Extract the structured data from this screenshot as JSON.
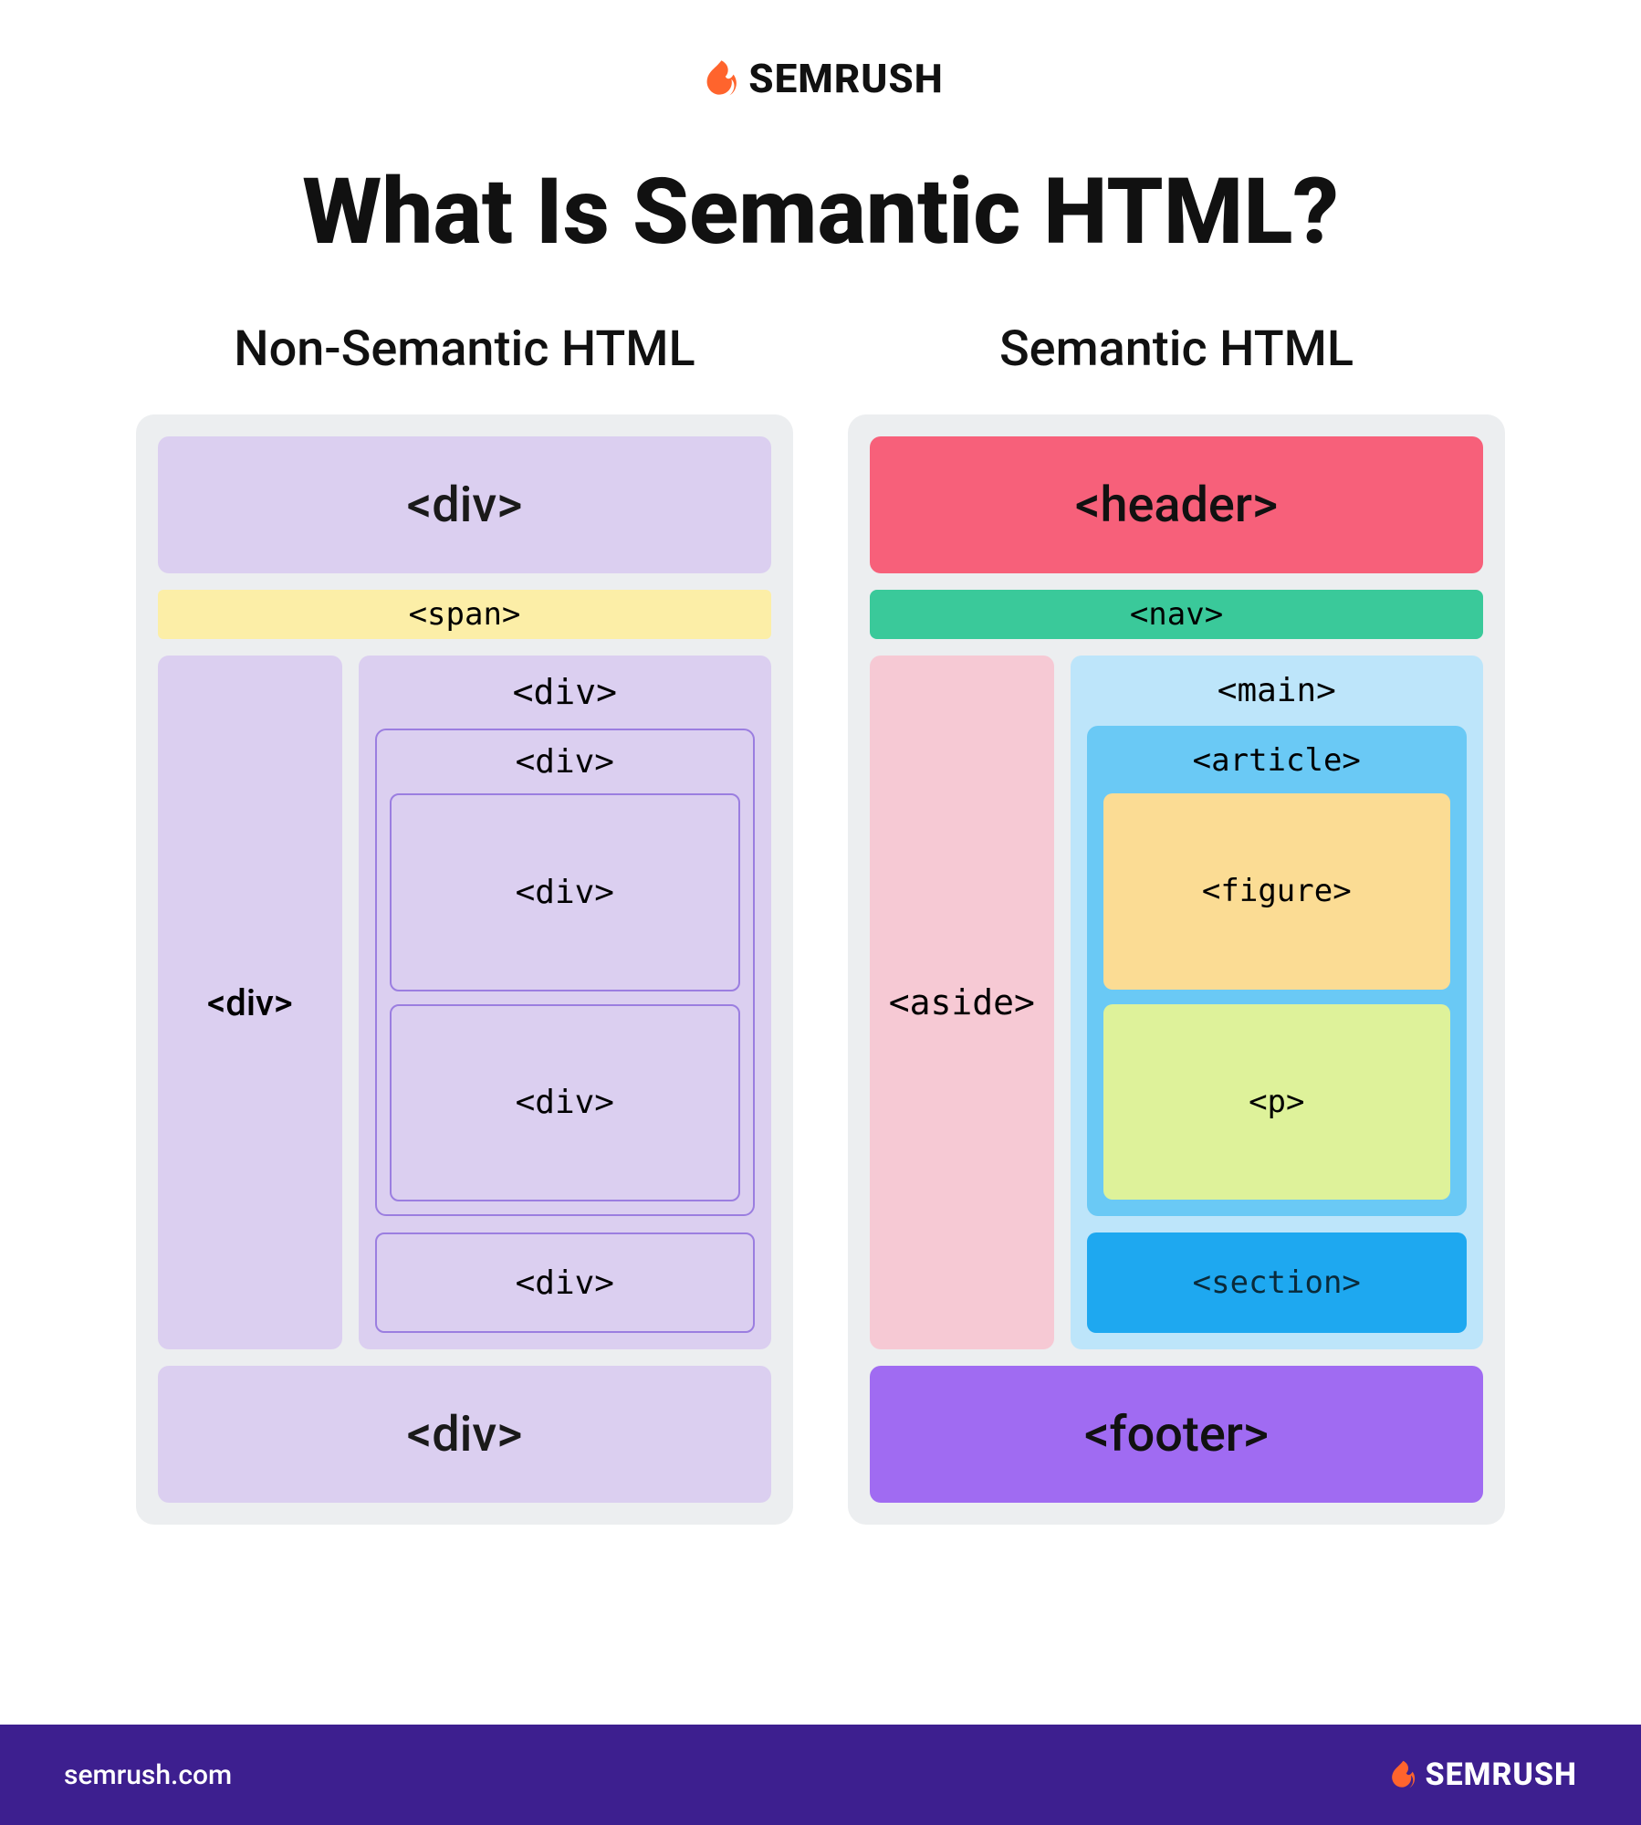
{
  "brand": {
    "name": "SEMRUSH",
    "color_accent": "#ff642d",
    "url": "semrush.com"
  },
  "title": "What Is Semantic HTML?",
  "columns": {
    "non_semantic": {
      "heading": "Non-Semantic HTML",
      "header": "<div>",
      "nav": "<span>",
      "aside": "<div>",
      "main": "<div>",
      "article": "<div>",
      "figure": "<div>",
      "p": "<div>",
      "section": "<div>",
      "footer": "<div>"
    },
    "semantic": {
      "heading": "Semantic HTML",
      "header": "<header>",
      "nav": "<nav>",
      "aside": "<aside>",
      "main": "<main>",
      "article": "<article>",
      "figure": "<figure>",
      "p": "<p>",
      "section": "<section>",
      "footer": "<footer>"
    }
  },
  "colors": {
    "frame_bg": "#eceef0",
    "ns_fill": "#dbcff0",
    "ns_outline": "#9b7ee0",
    "span_bg": "#fceea7",
    "header_bg": "#f7607a",
    "nav_bg": "#3ac99a",
    "aside_bg": "#f6c9d4",
    "main_bg": "#bde5fa",
    "article_bg": "#6ac9f5",
    "figure_bg": "#fbdc94",
    "p_bg": "#def29a",
    "section_bg": "#1ea8f0",
    "footer_bg": "#a06bf2",
    "footer_bar": "#3d1f8f"
  }
}
